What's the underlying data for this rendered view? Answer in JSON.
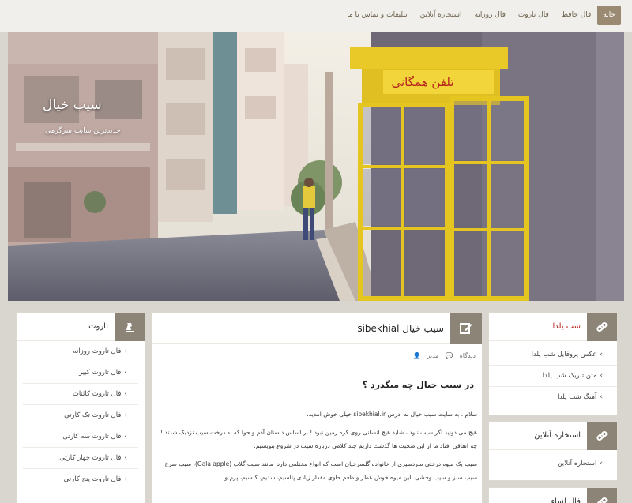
{
  "nav": {
    "items": [
      {
        "label": "خانه",
        "active": true
      },
      {
        "label": "فال حافظ",
        "active": false
      },
      {
        "label": "فال تاروت",
        "active": false
      },
      {
        "label": "فال روزانه",
        "active": false
      },
      {
        "label": "استخاره آنلاین",
        "active": false
      },
      {
        "label": "تبلیغات و تماس با ما",
        "active": false
      }
    ]
  },
  "hero": {
    "site_title": "سیب خیال",
    "tagline": "جدیدترین سایت سرگرمی",
    "booth_sign": "تلفن همگانی"
  },
  "left_widget": {
    "title": "تاروت",
    "items": [
      "فال تاروت روزانه",
      "فال تاروت کبیر",
      "فال تاروت کائنات",
      "فال تاروت تک کارتی",
      "فال تاروت سه کارتی",
      "فال تاروت چهار کارتی",
      "فال تاروت پنج کارتی"
    ]
  },
  "right_widgets": [
    {
      "title": "شب یلدا",
      "title_color": "#b5261e",
      "items": [
        "عکس پروفایل شب یلدا",
        "متن تبریک شب یلدا",
        "آهنگ شب یلدا"
      ]
    },
    {
      "title": "استخاره آنلاین",
      "title_color": "#333333",
      "items": [
        "استخاره آنلاین"
      ]
    },
    {
      "title": "فال انبیاء",
      "title_color": "#333333",
      "items": []
    }
  ],
  "post": {
    "title": "سیب خیال sibekhial",
    "author": "مدیر",
    "comments": "دیدگاه",
    "subtitle": "در سیب خیال چه میگذرد ؟",
    "paragraphs": [
      "سلام ، به سایت سیب خیال به آدرس sibekhial.ir خیلی خوش آمدید.",
      "هیچ می دونید اگر سیب نبود ، شاید هیچ انسانی روی کره زمین نبود ! بر اساس داستان آدم و حوا که به درخت سیب نزدیک شدند ! چه اتفاقی افتاد ما از این صحبت ها گذشت داریم چند کلامی درباره سیب در شروع بنویسیم.",
      "سیب یک میوه درختی سردسیری از خانواده گلسرخیان است که انواع مختلفی دارد، مانند سیب گلاب (Gala apple)، سیب سرخ، سیب سبز و سیب وحشی. این میوه خوش عطر و طعم حاوی مقدار زیادی پتاسیم، سدیم، کلسیم، پرم و"
    ]
  },
  "colors": {
    "accent": "#8c8577",
    "nav_active": "#9a8a72",
    "booth_yellow": "#e8c928"
  }
}
